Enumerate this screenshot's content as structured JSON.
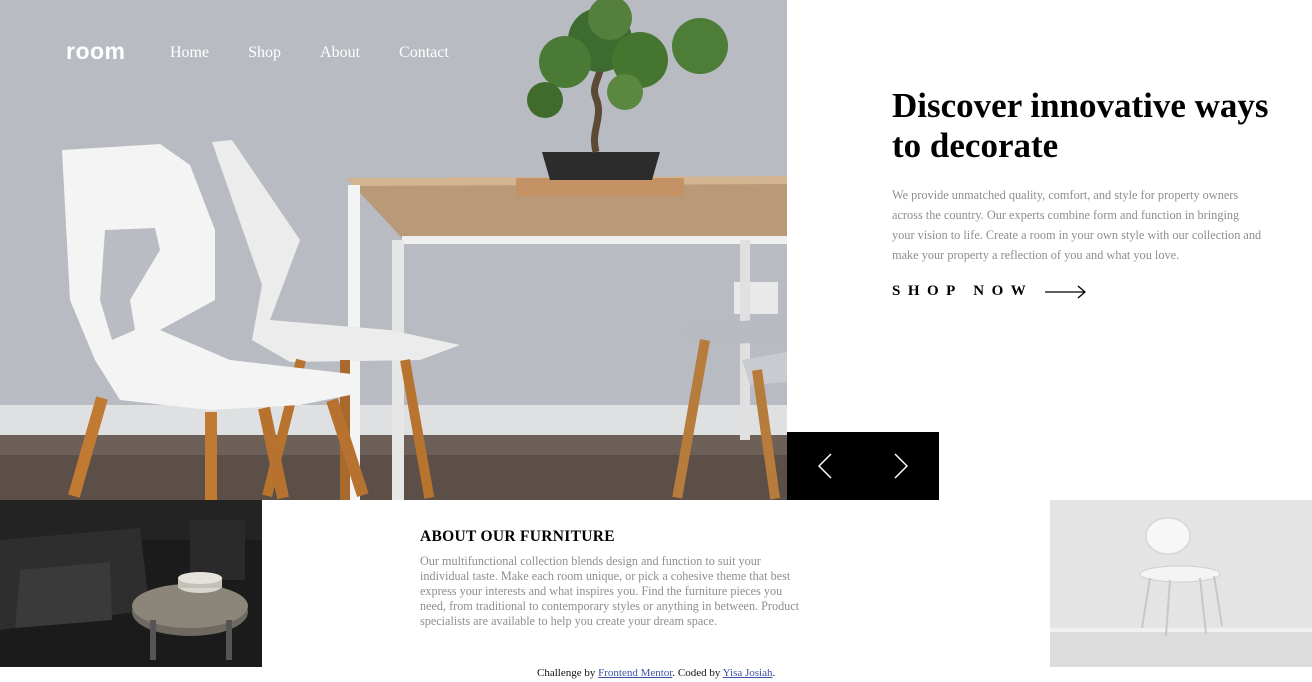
{
  "brand": {
    "logo": "room"
  },
  "nav": {
    "items": [
      {
        "label": "Home"
      },
      {
        "label": "Shop"
      },
      {
        "label": "About"
      },
      {
        "label": "Contact"
      }
    ]
  },
  "hero": {
    "title": "Discover innovative ways to decorate",
    "description": "We provide unmatched quality, comfort, and style for property owners across the country. Our experts combine form and function in bringing your vision to life. Create a room in your own style with our collection and make your property a reflection of you and what you love.",
    "cta_label": "SHOP NOW",
    "cta_icon": "arrow-right-icon"
  },
  "slider": {
    "prev_icon": "chevron-left-icon",
    "next_icon": "chevron-right-icon"
  },
  "about": {
    "title": "ABOUT OUR FURNITURE",
    "text": "Our multifunctional collection blends design and function to suit your individual taste. Make each room unique, or pick a cohesive theme that best express your interests and what inspires you. Find the furniture pieces you need, from traditional to contemporary styles or anything in between. Product specialists are available to help you create your dream space."
  },
  "footer": {
    "prefix": "Challenge by ",
    "link1": "Frontend Mentor",
    "middle": ". Coded by ",
    "link2": "Yisa Josiah",
    "suffix": "."
  },
  "colors": {
    "text_primary": "#000000",
    "text_muted": "#8e8e8e",
    "slider_bg": "#000000",
    "footer_link": "#3e52a3"
  }
}
